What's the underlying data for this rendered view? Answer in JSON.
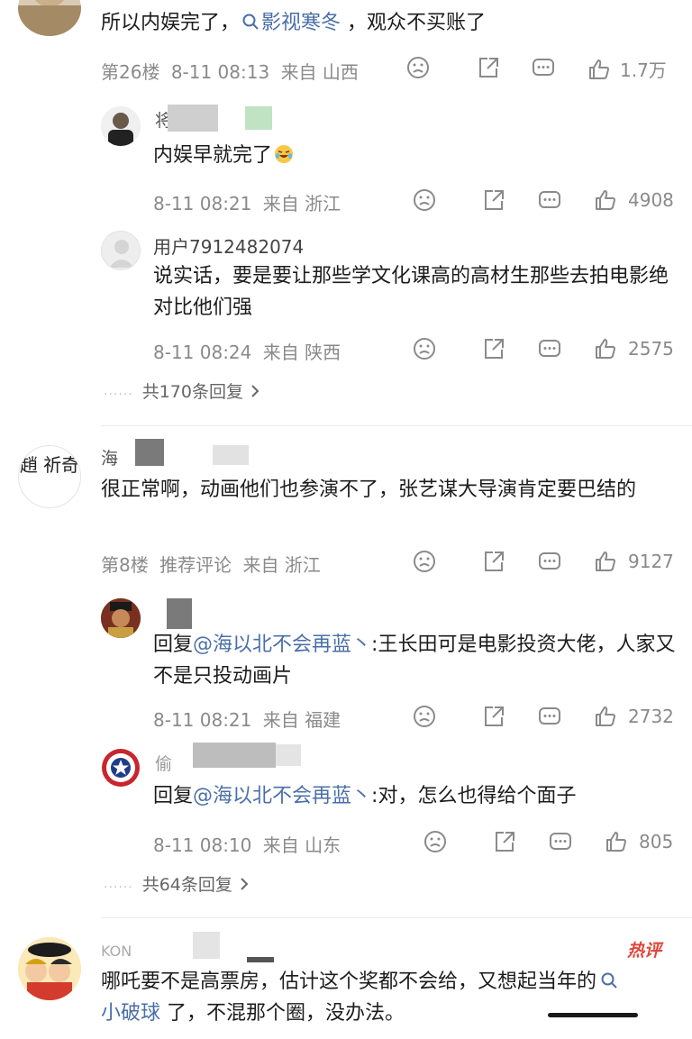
{
  "comments": [
    {
      "text_parts": [
        "所以内娱完了，",
        "影视寒冬",
        " ，观众不买账了"
      ],
      "floor": "第26楼",
      "time": "8-11 08:13",
      "location": "来自 山西",
      "likes": "1.7万"
    },
    {
      "author_fragment": "海",
      "text": "很正常啊，动画他们也参演不了，张艺谋大导演肯定要巴结的",
      "floor": "第8楼",
      "tag": "推荐评论",
      "location": "来自 浙江",
      "likes": "9127",
      "avatar_text": "趙 祈奇"
    },
    {
      "author_fragment": "KON",
      "text_parts": [
        "哪吒要不是高票房，估计这个奖都不会给，又想起当年的",
        "小破球",
        " 了，不混那个圈，没办法。"
      ],
      "hot_badge": "热评"
    }
  ],
  "replies_a": [
    {
      "author_fragment": "将",
      "text": "内娱早就完了",
      "time": "8-11 08:21",
      "location": "来自 浙江",
      "likes": "4908"
    },
    {
      "author": "用户7912482074",
      "text": "说实话，要是要让那些学文化课高的高材生那些去拍电影绝对比他们强",
      "time": "8-11 08:24",
      "location": "来自 陕西",
      "likes": "2575"
    }
  ],
  "replies_b": [
    {
      "text_prefix": "回复",
      "mention": "@海以北不会再蓝丶",
      "text": ":王长田可是电影投资大佬，人家又不是只投动画片",
      "time": "8-11 08:21",
      "location": "来自 福建",
      "likes": "2732"
    },
    {
      "author_fragment": "偷",
      "text_prefix": "回复",
      "mention": "@海以北不会再蓝丶",
      "text": ":对，怎么也得给个面子",
      "time": "8-11 08:10",
      "location": "来自 山东",
      "likes": "805"
    }
  ],
  "more_a": "共170条回复",
  "more_b": "共64条回复",
  "icons": {
    "search": "search-icon",
    "dislike": "frown-face-icon",
    "share": "share-icon",
    "comment": "comment-icon",
    "like": "thumbs-up-icon"
  },
  "colors": {
    "link": "#4a6fa8",
    "meta": "#8a8a8a",
    "hot": "#e0463a"
  }
}
